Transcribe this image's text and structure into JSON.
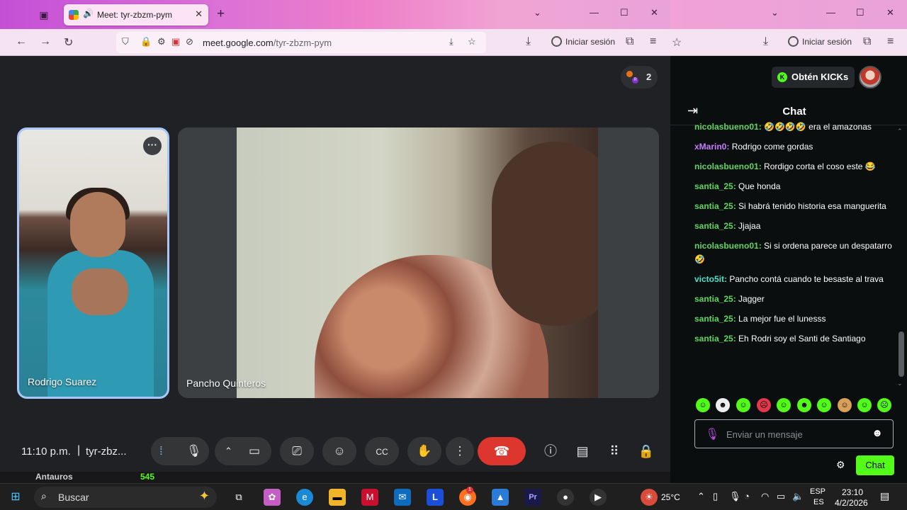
{
  "browser_left": {
    "tab_title": "Meet: tyr-zbzm-pym",
    "url_host": "meet.google.com",
    "url_path": "/tyr-zbzm-pym",
    "signin_label": "Iniciar sesión"
  },
  "browser_right": {
    "signin_label": "Iniciar sesión"
  },
  "meet": {
    "participant_count": "2",
    "participants": [
      {
        "name": "Rodrigo Suarez"
      },
      {
        "name": "Pancho Quinteros"
      }
    ],
    "clock": "11:10 p.m.",
    "separator": "|",
    "meeting_code": "tyr-zbz..."
  },
  "stream_bleed": {
    "name": "Antauros",
    "count": "545"
  },
  "kick": {
    "kicks_button": "Obtén KICKs",
    "chat_title": "Chat",
    "messages": [
      {
        "user": "nicolasbueno01",
        "color": "#60d660",
        "text": "🤣🤣🤣🤣 era el amazonas"
      },
      {
        "user": "xMarin0",
        "color": "#c77dff",
        "text": "Rodrigo come gordas"
      },
      {
        "user": "nicolasbueno01",
        "color": "#60d660",
        "text": "Rordigo corta el coso este 😂"
      },
      {
        "user": "santia_25",
        "color": "#60d660",
        "text": "Que honda"
      },
      {
        "user": "santia_25",
        "color": "#60d660",
        "text": "Si habrá tenido historia esa manguerita"
      },
      {
        "user": "santia_25",
        "color": "#60d660",
        "text": "Jjajaa"
      },
      {
        "user": "nicolasbueno01",
        "color": "#60d660",
        "text": "Si si ordena parece un despatarro🤣"
      },
      {
        "user": "victo5it",
        "color": "#4ee0c8",
        "text": "Pancho contá cuando te besaste al trava"
      },
      {
        "user": "santia_25",
        "color": "#60d660",
        "text": "Jagger"
      },
      {
        "user": "santia_25",
        "color": "#60d660",
        "text": "La mejor fue el lunesss"
      },
      {
        "user": "santia_25",
        "color": "#60d660",
        "text": "Eh Rodri soy el Santi de Santiago"
      }
    ],
    "input_placeholder": "Enviar un mensaje",
    "send_label": "Chat"
  },
  "taskbar": {
    "search_placeholder": "Buscar",
    "temperature": "25°C",
    "lang_line1": "ESP",
    "lang_line2": "ES",
    "time": "23:10",
    "date": "4/2/2026",
    "firefox_badge": "1"
  },
  "colors": {
    "kick_green": "#53fc18",
    "meet_bg": "#202124",
    "hangup_red": "#dc362e",
    "tile_active_border": "#a8c7fa"
  }
}
